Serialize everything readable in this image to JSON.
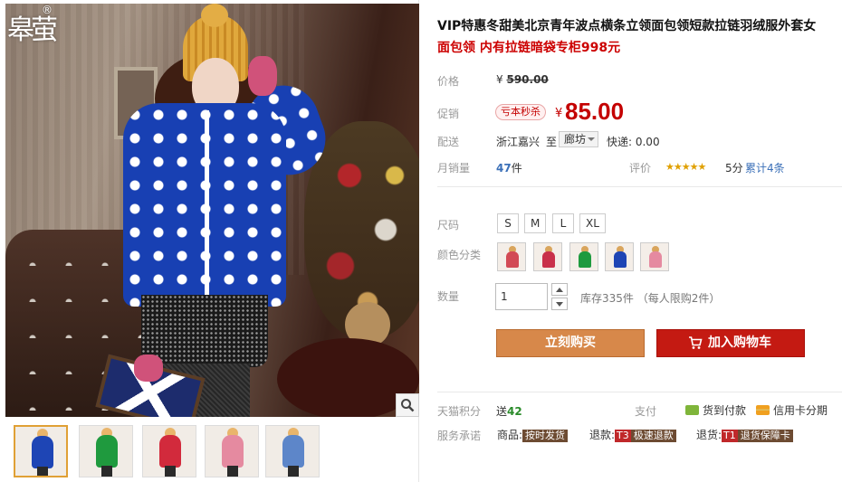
{
  "store": {
    "logo_text": "皋萤",
    "logo_reg": "®"
  },
  "gallery": {
    "thumbnails": [
      {
        "color": "#1e45b5",
        "active": true
      },
      {
        "color": "#1f9a3e",
        "active": false
      },
      {
        "color": "#d22a3c",
        "active": false
      },
      {
        "color": "#e58aa0",
        "active": false
      },
      {
        "color": "#5d86c9",
        "active": false
      }
    ]
  },
  "product": {
    "title": "VIP特惠冬甜美北京青年波点横条立领面包领短款拉链羽绒服外套女",
    "subtitle": "面包领 内有拉链暗袋专柜998元",
    "price_label": "价格",
    "price_currency": "¥",
    "original_price": "590.00",
    "promo_label": "促销",
    "promo_badge": "亏本秒杀",
    "promo_currency": "¥",
    "promo_price": "85.00",
    "delivery_label": "配送",
    "ship_from": "浙江嘉兴",
    "ship_to_word": "至",
    "ship_to_city": "廊坊",
    "shipping_fee": "快递: 0.00",
    "monthly_sales_label": "月销量",
    "monthly_sales_value": "47",
    "monthly_sales_unit": "件",
    "rating_label": "评价",
    "rating_stars": "★★★★★",
    "rating_score": "5分",
    "review_count": "累计4条",
    "size_label": "尺码",
    "sizes": [
      "S",
      "M",
      "L",
      "XL"
    ],
    "color_label": "颜色分类",
    "colors": [
      "#d24a55",
      "#c9304a",
      "#1e9a3e",
      "#1e45b5",
      "#e58aa0"
    ],
    "quantity_label": "数量",
    "quantity_value": "1",
    "stock_text": "库存335件 （每人限购2件）",
    "buy_now_label": "立刻购买",
    "add_to_cart_label": "加入购物车",
    "points_label": "天猫积分",
    "points_prefix": "送",
    "points_value": "42",
    "pay_label": "支付",
    "pay_cod": "货到付款",
    "pay_credit": "信用卡分期",
    "promise_label": "服务承诺",
    "promise_goods_label": "商品:",
    "promise_goods_tag": "按时发货",
    "promise_refund_label": "退款:",
    "promise_refund_code": "T3",
    "promise_refund_tag": "极速退款",
    "promise_return_label": "退货:",
    "promise_return_code": "T1",
    "promise_return_tag": "退货保障卡"
  },
  "colors": {
    "accent_red": "#c40000",
    "buy_orange": "#d7884a",
    "cart_red": "#c41a12",
    "link_blue": "#3b70b8"
  }
}
